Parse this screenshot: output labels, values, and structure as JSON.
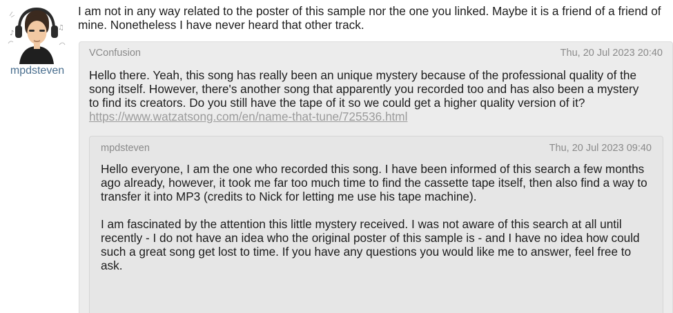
{
  "post": {
    "author": "mpdsteven",
    "text": "I am not in any way related to the poster of this sample nor the one you linked. Maybe it is a friend of a friend of mine. Nonetheless I have never heard that other track."
  },
  "quote": {
    "author": "VConfusion",
    "date": "Thu, 20 Jul 2023 20:40",
    "text": "Hello there. Yeah, this song has really been an unique mystery because of the professional quality of the song itself. However, there's another song that apparently you recorded too and has also been a mystery to find its creators. Do you still have the tape of it so we could get a higher quality version of it?",
    "link": "https://www.watzatsong.com/en/name-that-tune/725536.html"
  },
  "nested_quote": {
    "author": "mpdsteven",
    "date": "Thu, 20 Jul 2023 09:40",
    "paragraph1": "Hello everyone, I am the one who recorded this song. I have been informed of this search a few months ago already, however, it took me far too much time to find the cassette tape itself, then also find a way to transfer it into MP3 (credits to Nick for letting me use his tape machine).",
    "paragraph2": "I am fascinated by the attention this little mystery received. I was not aware of this search at all until recently - I do not have an idea who the original poster of this sample is - and I have no idea how could such a great song get lost to time. If you have any questions you would like me to answer, feel free to ask."
  },
  "icons": {
    "avatar": "headphones-person-avatar"
  }
}
